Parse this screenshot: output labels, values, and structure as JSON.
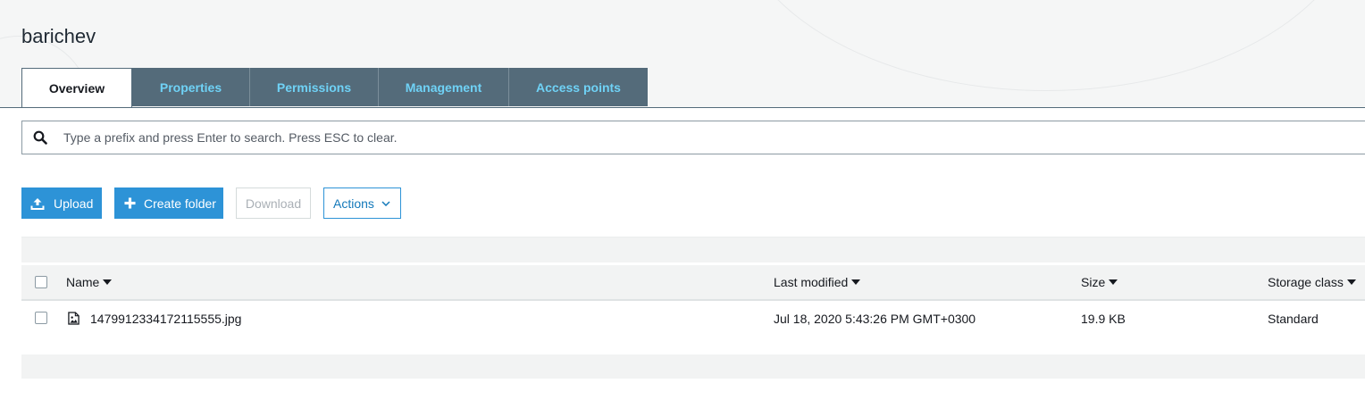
{
  "page": {
    "title": "barichev"
  },
  "tabs": [
    {
      "label": "Overview",
      "active": true
    },
    {
      "label": "Properties",
      "active": false
    },
    {
      "label": "Permissions",
      "active": false
    },
    {
      "label": "Management",
      "active": false
    },
    {
      "label": "Access points",
      "active": false
    }
  ],
  "search": {
    "placeholder": "Type a prefix and press Enter to search. Press ESC to clear.",
    "value": "",
    "icon": "search-icon"
  },
  "toolbar": {
    "upload_label": "Upload",
    "upload_icon": "upload-icon",
    "create_folder_label": "Create folder",
    "create_folder_icon": "plus-icon",
    "download_label": "Download",
    "actions_label": "Actions",
    "actions_icon": "chevron-down-icon"
  },
  "table": {
    "columns": [
      {
        "label": "Name",
        "sort_icon": "caret-down-icon"
      },
      {
        "label": "Last modified",
        "sort_icon": "caret-down-icon"
      },
      {
        "label": "Size",
        "sort_icon": "caret-down-icon"
      },
      {
        "label": "Storage class",
        "sort_icon": "caret-down-icon"
      }
    ],
    "rows": [
      {
        "icon": "image-file-icon",
        "name": "1479912334172115555.jpg",
        "last_modified": "Jul 18, 2020 5:43:26 PM GMT+0300",
        "size": "19.9 KB",
        "storage_class": "Standard"
      }
    ]
  },
  "colors": {
    "tab_bg": "#546b7a",
    "tab_text": "#6fd2f6",
    "primary_button": "#2d93d7",
    "header_band": "#f5f6f6"
  }
}
